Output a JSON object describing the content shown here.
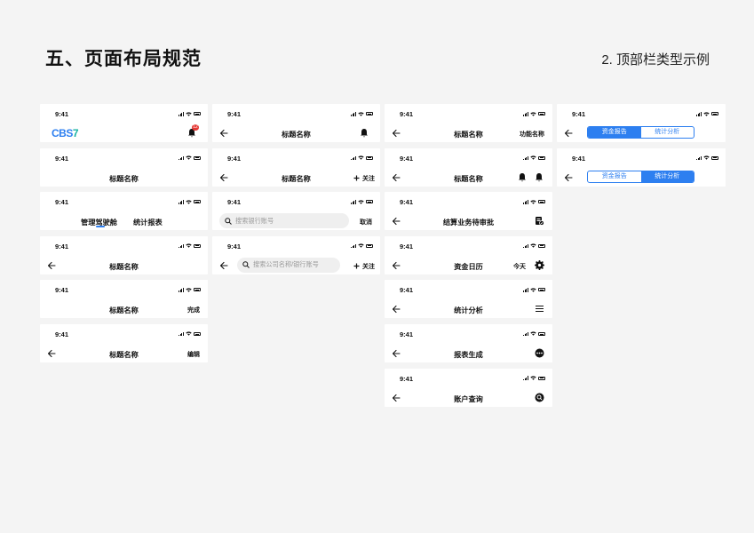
{
  "header": {
    "title": "五、页面布局规范",
    "subtitle": "2. 顶部栏类型示例"
  },
  "status_time": "9:41",
  "col1": {
    "c1": {
      "logo_main": "CBS",
      "logo_accent": "7",
      "badge": "12"
    },
    "c2": {
      "title": "标题名称"
    },
    "c3": {
      "tab_a": "管理驾驶舱",
      "tab_b": "统计报表"
    },
    "c4": {
      "title": "标题名称"
    },
    "c5": {
      "title": "标题名称",
      "action": "完成"
    },
    "c6": {
      "title": "标题名称",
      "action": "编辑"
    }
  },
  "col2": {
    "c1": {
      "title": "标题名称"
    },
    "c2": {
      "title": "标题名称",
      "action": "关注"
    },
    "c3": {
      "placeholder": "搜索银行账号",
      "action": "取消"
    },
    "c4": {
      "placeholder": "搜索公司名称/银行账号",
      "action": "关注"
    }
  },
  "col3": {
    "c1": {
      "title": "标题名称",
      "action": "功能名称"
    },
    "c2": {
      "title": "标题名称"
    },
    "c3": {
      "title": "结算业务待审批"
    },
    "c4": {
      "title": "资金日历",
      "action": "今天"
    },
    "c5": {
      "title": "统计分析"
    },
    "c6": {
      "title": "报表生成"
    },
    "c7": {
      "title": "账户查询"
    }
  },
  "col4": {
    "c1": {
      "seg_a": "资金报告",
      "seg_b": "统计分析",
      "active": "a"
    },
    "c2": {
      "seg_a": "资金报告",
      "seg_b": "统计分析",
      "active": "b"
    }
  },
  "icons": [
    "back-arrow-icon",
    "bell-icon",
    "plus-icon",
    "search-icon",
    "doc-check-icon",
    "gear-icon",
    "menu-icon",
    "more-icon",
    "search-circle-icon",
    "signal-icon",
    "wifi-icon",
    "battery-icon"
  ],
  "colors": {
    "accent": "#2d7ff0",
    "badge": "#e53935",
    "logo_accent": "#19b3a2",
    "background": "#f4f4f4"
  }
}
